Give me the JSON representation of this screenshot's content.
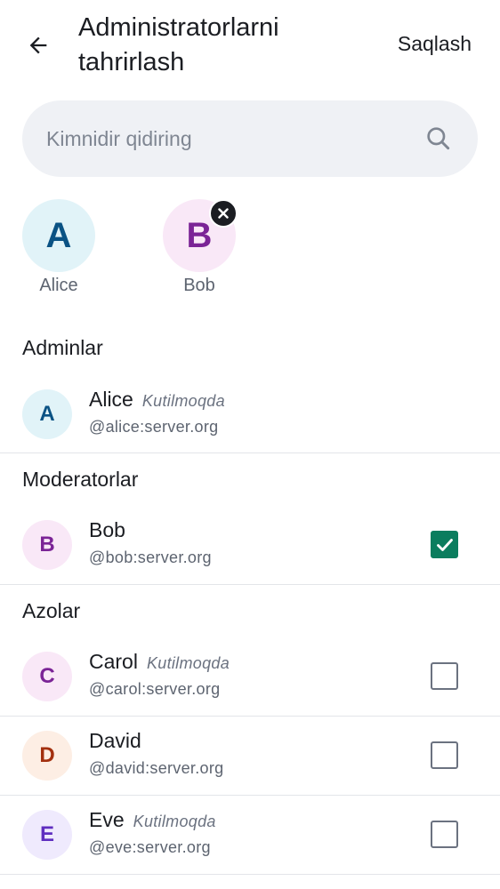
{
  "header": {
    "title": "Administratorlarni tahrirlash",
    "save_label": "Saqlash"
  },
  "search": {
    "placeholder": "Kimnidir qidiring",
    "value": ""
  },
  "selected": [
    {
      "initial": "A",
      "label": "Alice",
      "removable": false
    },
    {
      "initial": "B",
      "label": "Bob",
      "removable": true
    }
  ],
  "sections": {
    "admins": "Adminlar",
    "moderators": "Moderatorlar",
    "members": "Azolar"
  },
  "admins": [
    {
      "initial": "A",
      "name": "Alice",
      "status": "Kutilmoqda",
      "id": "@alice:server.org"
    }
  ],
  "moderators": [
    {
      "initial": "B",
      "name": "Bob",
      "status": "",
      "id": "@bob:server.org",
      "checked": true
    }
  ],
  "members": [
    {
      "initial": "C",
      "name": "Carol",
      "status": "Kutilmoqda",
      "id": "@carol:server.org",
      "checked": false
    },
    {
      "initial": "D",
      "name": "David",
      "status": "",
      "id": "@david:server.org",
      "checked": false
    },
    {
      "initial": "E",
      "name": "Eve",
      "status": "Kutilmoqda",
      "id": "@eve:server.org",
      "checked": false
    }
  ],
  "colors": {
    "accent": "#0b7d5e",
    "avatar_a_bg": "#e1f3f8",
    "avatar_a_fg": "#0a5284",
    "avatar_b_bg": "#f9e8f7",
    "avatar_b_fg": "#7b2496",
    "avatar_c_bg": "#f9e8f7",
    "avatar_c_fg": "#7b2496",
    "avatar_d_bg": "#fdeee4",
    "avatar_d_fg": "#a3300f",
    "avatar_e_bg": "#efeafd",
    "avatar_e_fg": "#5f2ec0"
  },
  "icons": {
    "back": "arrow-left-icon",
    "search": "search-icon",
    "remove": "close-icon",
    "check": "checkmark-icon"
  }
}
